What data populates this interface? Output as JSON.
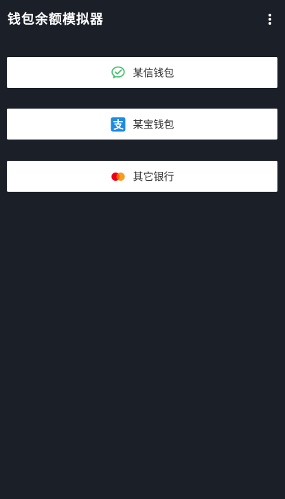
{
  "app_bar": {
    "title": "钱包余额模拟器",
    "menu_icon": "more-vertical-icon"
  },
  "wallets": [
    {
      "label": "某信钱包",
      "icon": "chat-bubble-check-icon",
      "color": "#46c06b"
    },
    {
      "label": "某宝钱包",
      "icon": "alipay-icon",
      "color": "#1e8be0"
    },
    {
      "label": "其它银行",
      "icon": "mastercard-icon",
      "color": "#eb001b"
    }
  ],
  "colors": {
    "background": "#1b1f27",
    "button": "#ffffff",
    "title_text": "#ffffff",
    "button_text": "#333333"
  }
}
